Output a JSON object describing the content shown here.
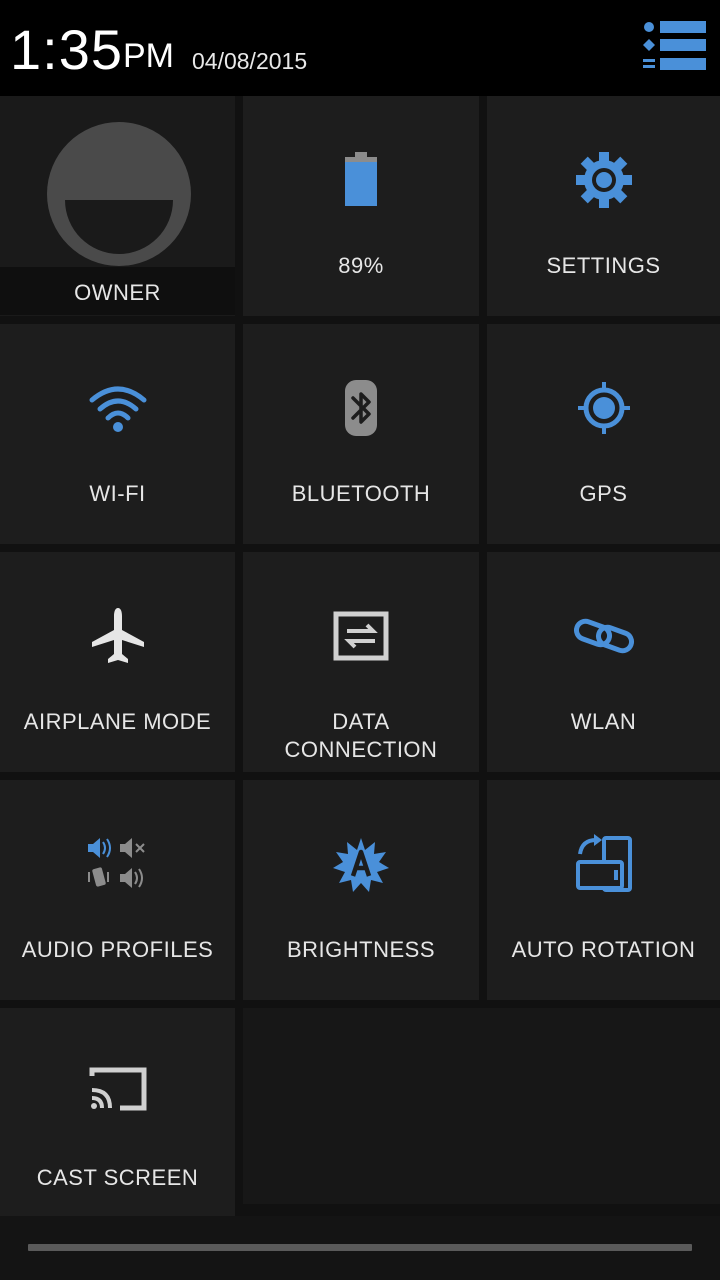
{
  "status": {
    "time": "1:35",
    "ampm": "PM",
    "date": "04/08/2015"
  },
  "tiles": {
    "owner": {
      "label": "OWNER",
      "icon": "user-avatar-icon"
    },
    "battery": {
      "label": "89%",
      "icon": "battery-icon",
      "level_percent": 89
    },
    "settings": {
      "label": "SETTINGS",
      "icon": "gear-icon"
    },
    "wifi": {
      "label": "WI-FI",
      "icon": "wifi-icon"
    },
    "bluetooth": {
      "label": "BLUETOOTH",
      "icon": "bluetooth-icon"
    },
    "gps": {
      "label": "GPS",
      "icon": "gps-icon"
    },
    "airplane": {
      "label": "AIRPLANE MODE",
      "icon": "airplane-icon"
    },
    "data": {
      "label_line1": "DATA",
      "label_line2": "CONNECTION",
      "icon": "data-transfer-icon"
    },
    "wlan": {
      "label": "WLAN",
      "icon": "link-icon"
    },
    "audio": {
      "label": "AUDIO PROFILES",
      "icon": "audio-profiles-icon"
    },
    "brightness": {
      "label": "BRIGHTNESS",
      "icon": "auto-brightness-icon"
    },
    "rotation": {
      "label": "AUTO ROTATION",
      "icon": "auto-rotate-icon"
    },
    "cast": {
      "label": "CAST SCREEN",
      "icon": "cast-icon"
    }
  },
  "colors": {
    "accent": "#4a90d9",
    "inactive": "#8c8c8c",
    "tile_bg": "#1d1d1d",
    "background": "#111111"
  }
}
